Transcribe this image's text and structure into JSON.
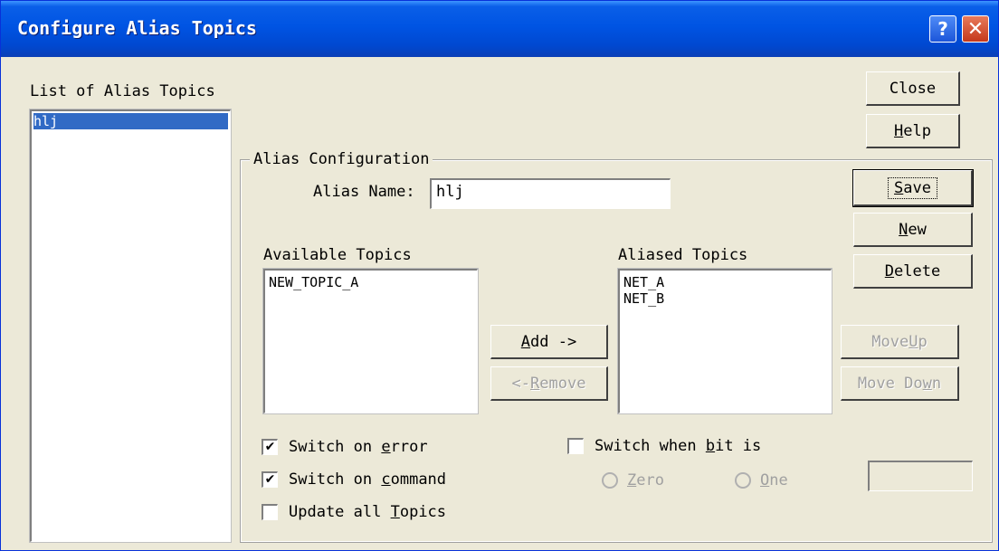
{
  "window": {
    "title": "Configure Alias Topics",
    "help_glyph": "?",
    "close_glyph": "✕"
  },
  "alias_list": {
    "label": "List of Alias Topics",
    "items": [
      "hlj"
    ]
  },
  "buttons": {
    "close": "Close",
    "help_pre": "",
    "help_u": "H",
    "help_post": "elp",
    "save_pre": "",
    "save_u": "S",
    "save_post": "ave",
    "new_pre": "",
    "new_u": "N",
    "new_post": "ew",
    "delete_pre": "",
    "delete_u": "D",
    "delete_post": "elete",
    "move_up_pre": "Move ",
    "move_up_u": "U",
    "move_up_post": "p",
    "move_down_pre": "Move Do",
    "move_down_u": "w",
    "move_down_post": "n",
    "add_pre": "",
    "add_u": "A",
    "add_post": "dd ->",
    "remove_pre": "<- ",
    "remove_u": "R",
    "remove_post": "emove"
  },
  "alias_config": {
    "group_label": "Alias Configuration",
    "alias_name_label": "Alias Name:",
    "alias_name_value": "hlj",
    "available_label": "Available Topics",
    "available_items": [
      "NEW_TOPIC_A"
    ],
    "aliased_label": "Aliased Topics",
    "aliased_items": [
      "NET_A",
      "NET_B"
    ]
  },
  "options": {
    "switch_on_error": {
      "pre": "Switch on ",
      "u": "e",
      "post": "rror",
      "checked": true
    },
    "switch_on_command": {
      "pre": "Switch on ",
      "u": "c",
      "post": "ommand",
      "checked": true
    },
    "update_all_topics": {
      "pre": "Update all ",
      "u": "T",
      "post": "opics",
      "checked": false
    },
    "switch_when_bit": {
      "pre": "Switch when ",
      "u": "b",
      "post": "it is",
      "checked": false
    },
    "zero": {
      "pre": "",
      "u": "Z",
      "post": "ero"
    },
    "one": {
      "pre": "",
      "u": "O",
      "post": "ne"
    },
    "check_mark": "✔",
    "bit_value": ""
  }
}
